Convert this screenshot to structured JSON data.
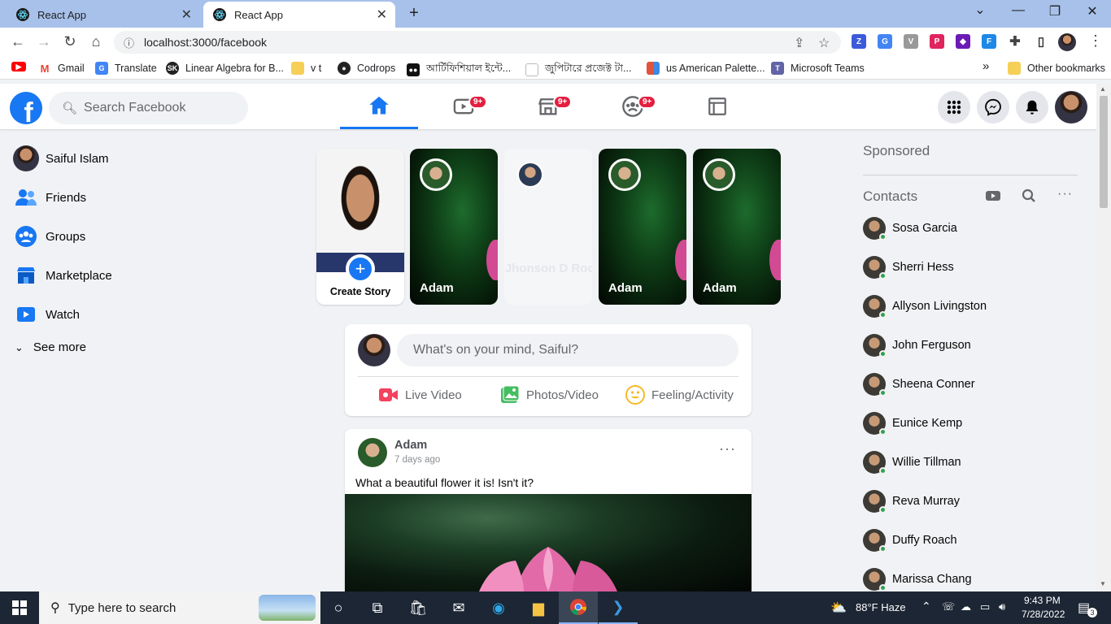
{
  "browser": {
    "tabs": [
      {
        "label": "React App",
        "close": "✕"
      },
      {
        "label": "React App",
        "close": "✕"
      }
    ],
    "new_tab": "+",
    "window_controls": {
      "minimize": "—",
      "restore": "❐",
      "close": "✕",
      "tab_search": "⌄"
    },
    "url": "localhost:3000/facebook",
    "bookmarks": [
      {
        "label": "",
        "icon": "youtube-icon",
        "color": "#ff0000"
      },
      {
        "label": "Gmail",
        "icon": "gmail-icon",
        "color": "#ea4335"
      },
      {
        "label": "Translate",
        "icon": "translate-icon",
        "color": "#4285f4"
      },
      {
        "label": "Linear Algebra for B...",
        "icon": "sk-icon",
        "color": "#222222"
      },
      {
        "label": "v t",
        "icon": "folder-icon",
        "color": "#f6cf57"
      },
      {
        "label": "Codrops",
        "icon": "github-icon",
        "color": "#222222"
      },
      {
        "label": "আর্টিফিশিয়াল ইন্টে...",
        "icon": "video-icon",
        "color": "#111111"
      },
      {
        "label": "জুপিটারে প্রজেক্ট টা...",
        "icon": "page-icon",
        "color": "#dddddd"
      },
      {
        "label": "us American Palette...",
        "icon": "palette-icon",
        "color": "#e3533b"
      },
      {
        "label": "Microsoft Teams",
        "icon": "teams-icon",
        "color": "#6264a7"
      }
    ],
    "more_bookmarks": "»",
    "other_bookmarks": "Other bookmarks"
  },
  "fb": {
    "search_placeholder": "Search Facebook",
    "nav_badges": [
      "9+",
      "9+",
      "9+"
    ],
    "user_name": "Saiful Islam",
    "left_menu": [
      {
        "label": "Friends",
        "icon": "friends-icon"
      },
      {
        "label": "Groups",
        "icon": "groups-icon"
      },
      {
        "label": "Marketplace",
        "icon": "marketplace-icon"
      },
      {
        "label": "Watch",
        "icon": "watch-icon"
      }
    ],
    "see_more": "See more",
    "stories": {
      "create_label": "Create Story",
      "items": [
        {
          "name": "Adam"
        },
        {
          "name": "Jhonson D Rock"
        },
        {
          "name": "Adam"
        },
        {
          "name": "Adam"
        }
      ]
    },
    "composer": {
      "placeholder": "What's on your mind, Saiful?",
      "actions": [
        {
          "label": "Live Video",
          "icon": "live-video-icon",
          "color": "#f3425f"
        },
        {
          "label": "Photos/Video",
          "icon": "photos-icon",
          "color": "#45bd62"
        },
        {
          "label": "Feeling/Activity",
          "icon": "feeling-icon",
          "color": "#f7b928"
        }
      ]
    },
    "post": {
      "author": "Adam",
      "time": "7 days ago",
      "text": "What a beautiful flower it is! Isn't it?"
    },
    "sponsored": "Sponsored",
    "contacts_title": "Contacts",
    "contacts": [
      "Sosa Garcia",
      "Sherri Hess",
      "Allyson Livingston",
      "John Ferguson",
      "Sheena Conner",
      "Eunice Kemp",
      "Willie Tillman",
      "Reva Murray",
      "Duffy Roach",
      "Marissa Chang"
    ]
  },
  "taskbar": {
    "search_placeholder": "Type here to search",
    "weather": "88°F  Haze",
    "time": "9:43 PM",
    "date": "7/28/2022",
    "notifications": "3"
  },
  "colors": {
    "fb_blue": "#1877f2",
    "badge_red": "#e41e3f",
    "online_green": "#31a24c"
  }
}
